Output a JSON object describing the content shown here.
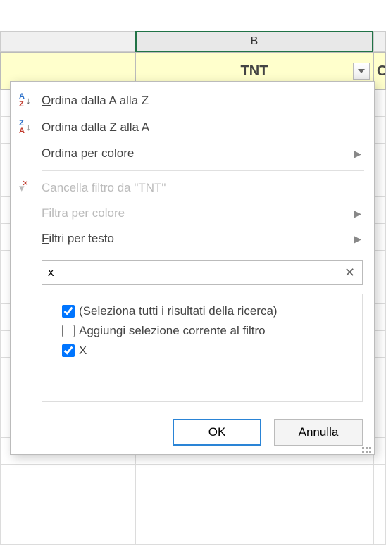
{
  "columns": {
    "b_letter": "B",
    "b_header": "TNT",
    "c_header_fragment": "OL"
  },
  "menu": {
    "sort_az_pre": "O",
    "sort_az_post": "rdina dalla A alla Z",
    "sort_za_pre": "Ordina ",
    "sort_za_u": "d",
    "sort_za_post": "alla Z alla A",
    "sort_color_pre": "Ordina per ",
    "sort_color_u": "c",
    "sort_color_post": "olore",
    "clear_filter": "Cancella filtro da \"TNT\"",
    "filter_color_pre": "F",
    "filter_color_u": "i",
    "filter_color_post": "ltra per colore",
    "text_filters_pre": "",
    "text_filters_u": "F",
    "text_filters_post": "iltri per testo"
  },
  "search": {
    "value": "x"
  },
  "checkboxes": {
    "select_all": "(Seleziona tutti i risultati della ricerca)",
    "add_current": "Aggiungi selezione corrente al filtro",
    "item_x": "X"
  },
  "buttons": {
    "ok": "OK",
    "cancel": "Annulla"
  }
}
